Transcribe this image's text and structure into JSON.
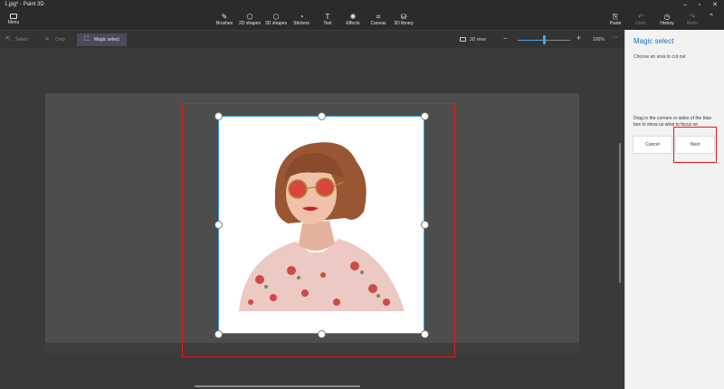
{
  "window": {
    "title": "1.jpg* - Paint 3D"
  },
  "ribbon": {
    "menu_label": "Menu",
    "tools": [
      {
        "label": "Brushes",
        "icon": "brush-icon",
        "glyph": "✎"
      },
      {
        "label": "2D shapes",
        "icon": "shapes-2d-icon",
        "glyph": "⬠"
      },
      {
        "label": "3D shapes",
        "icon": "cube-icon",
        "glyph": "⬡"
      },
      {
        "label": "Stickers",
        "icon": "sticker-icon",
        "glyph": "◔"
      },
      {
        "label": "Text",
        "icon": "text-icon",
        "glyph": "T"
      },
      {
        "label": "Effects",
        "icon": "effects-icon",
        "glyph": "✺"
      },
      {
        "label": "Canvas",
        "icon": "canvas-icon",
        "glyph": "⌗"
      },
      {
        "label": "3D library",
        "icon": "library-icon",
        "glyph": "⛁"
      }
    ],
    "right_tools": [
      {
        "label": "Paste",
        "icon": "paste-icon",
        "glyph": "⎘"
      },
      {
        "label": "Undo",
        "icon": "undo-icon",
        "glyph": "↶"
      },
      {
        "label": "History",
        "icon": "history-icon",
        "glyph": "◷"
      },
      {
        "label": "Redo",
        "icon": "redo-icon",
        "glyph": "↷"
      }
    ]
  },
  "toolbar": {
    "select_label": "Select",
    "crop_label": "Crop",
    "magic_select_label": "Magic select",
    "view3d_label": "3D view",
    "zoom_percent": "100%",
    "zoom_level": 0.5
  },
  "panel": {
    "title": "Magic select",
    "subtitle": "Choose an area to cut out",
    "help_text": "Drag in the corners or sides of the blue box to show us what to focus on.",
    "cancel_label": "Cancel",
    "next_label": "Next"
  },
  "colors": {
    "accent": "#1a6fc2",
    "selection_border": "#3aa0e0",
    "highlight_red": "#e81818"
  }
}
